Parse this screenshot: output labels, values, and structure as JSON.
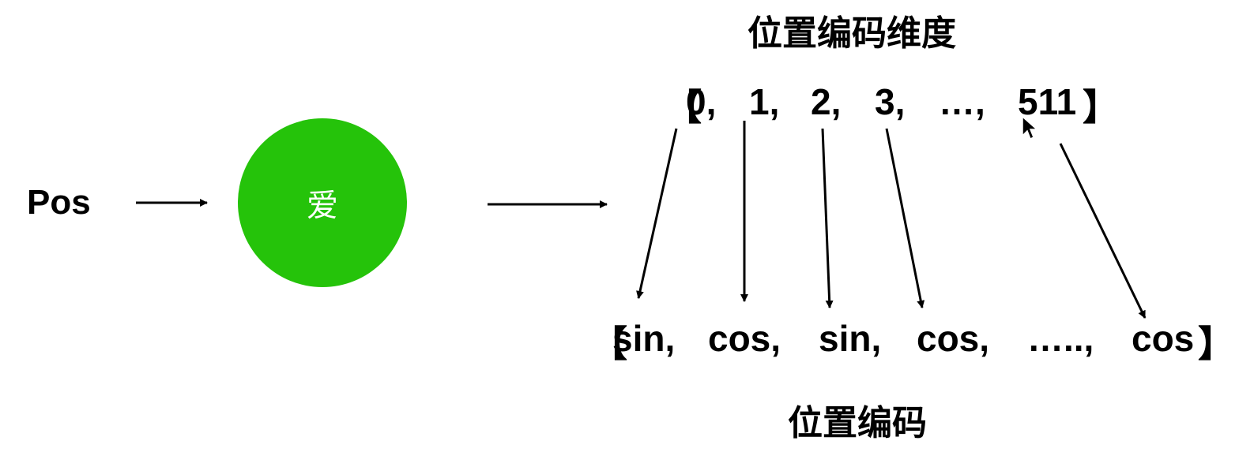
{
  "input_label": "Pos",
  "node_label": "爱",
  "node_color": "#25c30a",
  "top_title": "位置编码维度",
  "bottom_title": "位置编码",
  "dimensions": {
    "open_bracket": "【",
    "close_bracket": "】",
    "items": [
      "0,",
      "1,",
      "2,",
      "3,",
      "…,",
      "511"
    ]
  },
  "encodings": {
    "open_bracket": "【",
    "close_bracket": "】",
    "items": [
      "sin,",
      "cos,",
      "sin,",
      "cos,",
      "…..,",
      "cos"
    ]
  },
  "cursor_icon": "mouse-pointer-icon"
}
